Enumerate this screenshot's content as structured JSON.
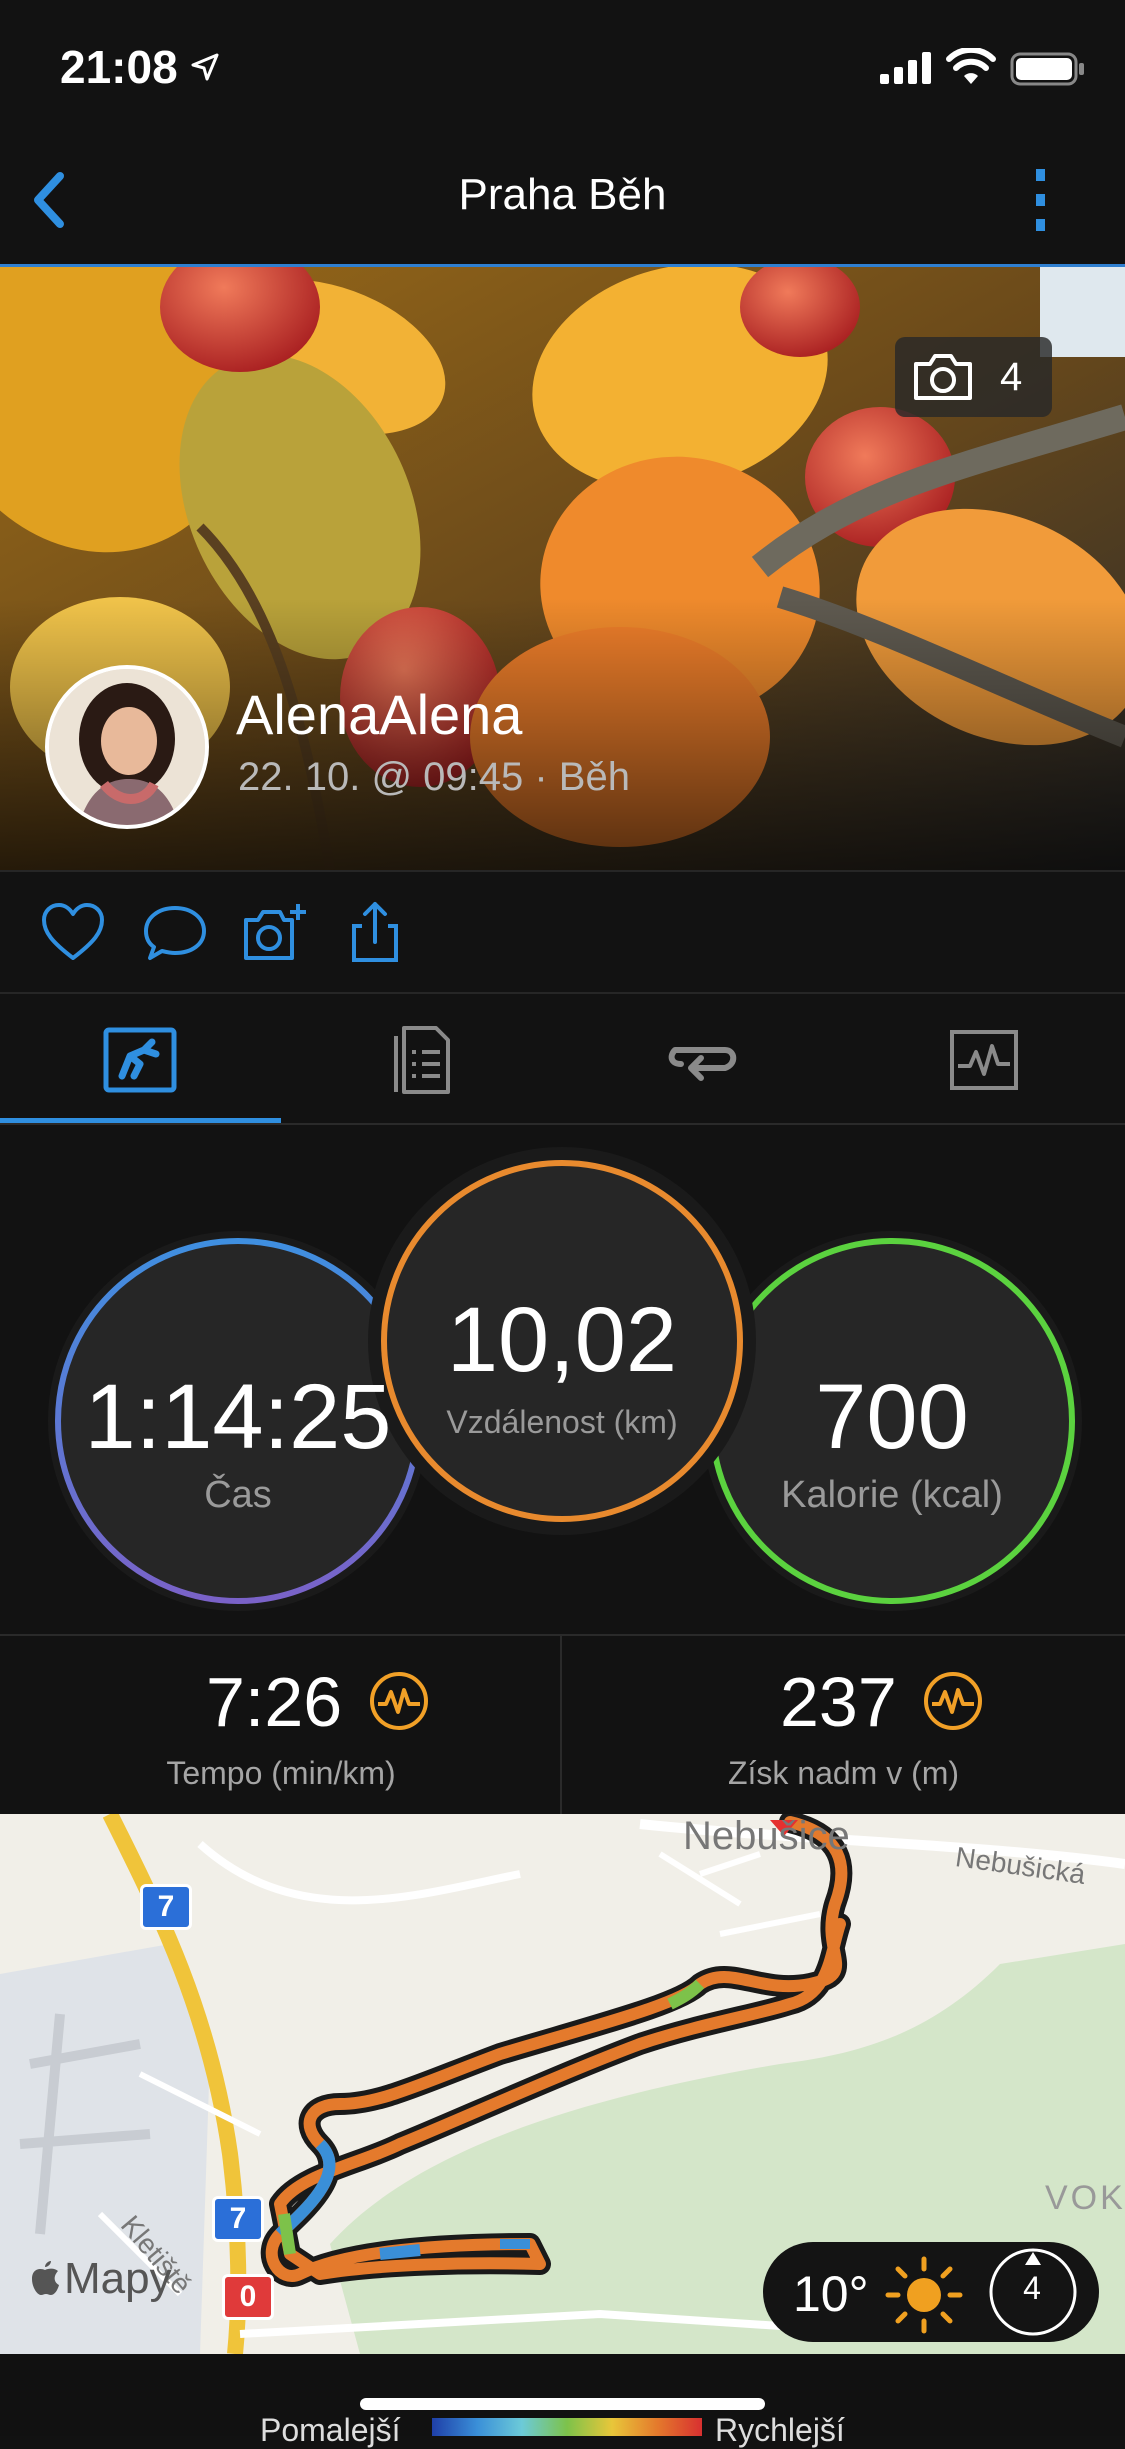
{
  "status_bar": {
    "time": "21:08"
  },
  "nav": {
    "title": "Praha Běh"
  },
  "hero": {
    "photo_count": "4",
    "user_name": "AlenaAlena",
    "subtitle": "22. 10. @ 09:45 · Běh"
  },
  "tabs": [
    {
      "icon": "summary-run-icon",
      "selected": true
    },
    {
      "icon": "details-list-icon",
      "selected": false
    },
    {
      "icon": "laps-loop-icon",
      "selected": false
    },
    {
      "icon": "graph-icon",
      "selected": false
    }
  ],
  "stats": {
    "time": {
      "value": "1:14:25",
      "label": "Čas"
    },
    "distance": {
      "value": "10,02",
      "label": "Vzdálenost (km)"
    },
    "calories": {
      "value": "700",
      "label": "Kalorie (kcal)"
    },
    "pace": {
      "value": "7:26",
      "label": "Tempo (min/km)"
    },
    "ascent": {
      "value": "237",
      "label": "Získ nadm v (m)"
    }
  },
  "map": {
    "labels": {
      "town": "Nebušice",
      "street": "Nebušická",
      "street2": "Kletiště",
      "vokovice": "VOKO",
      "attribution": "Mapy"
    },
    "road_badges": [
      "7",
      "7"
    ],
    "start_badge": "0",
    "weather": {
      "temp": "10°",
      "wind": "4"
    }
  },
  "legend": {
    "slower": "Pomalejší",
    "faster": "Rychlejší"
  },
  "colors": {
    "accent_blue": "#2f8fe0",
    "ring_orange": "#e88a2e",
    "ring_green": "#5bd23f",
    "ring_blue_start": "#3f8fe0",
    "ring_purple_end": "#7a62c8",
    "icon_orange": "#f1a027"
  }
}
